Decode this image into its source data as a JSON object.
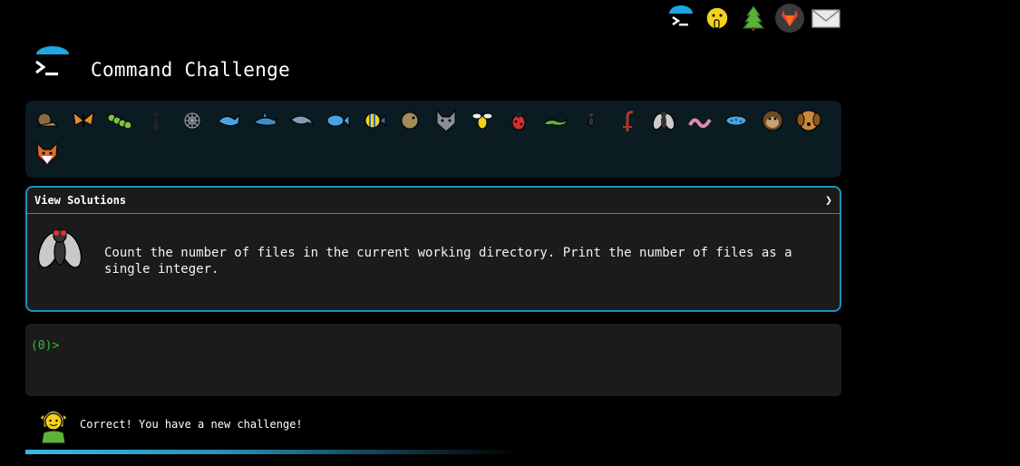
{
  "header": {
    "title": "Command Challenge"
  },
  "top_icons": [
    "terminal-icon",
    "shushing-face-icon",
    "tree-icon",
    "gitlab-icon",
    "mail-icon"
  ],
  "animals": [
    "snail",
    "butterfly",
    "caterpillar",
    "ant",
    "spider-web",
    "whale",
    "shark",
    "dolphin",
    "fish",
    "tropical-fish",
    "blowfish",
    "wolf",
    "bee",
    "ladybug",
    "lizard",
    "bug",
    "scorpion",
    "fly",
    "worm",
    "microbe",
    "monkey",
    "dog",
    "fox"
  ],
  "challenge": {
    "header_label": "View Solutions",
    "chevron": "❯",
    "description": "Count the number of files in the current working directory. Print the number of files as a single integer."
  },
  "terminal": {
    "prompt": "(0)>"
  },
  "feedback": {
    "message": "Correct! You have a new challenge!"
  },
  "progress": {
    "fraction": 0.5
  },
  "colors": {
    "accent": "#1f8fb8",
    "prompt": "#2fc13a",
    "panel": "#1b1b1b",
    "animal_bar": "#0a1b22"
  }
}
